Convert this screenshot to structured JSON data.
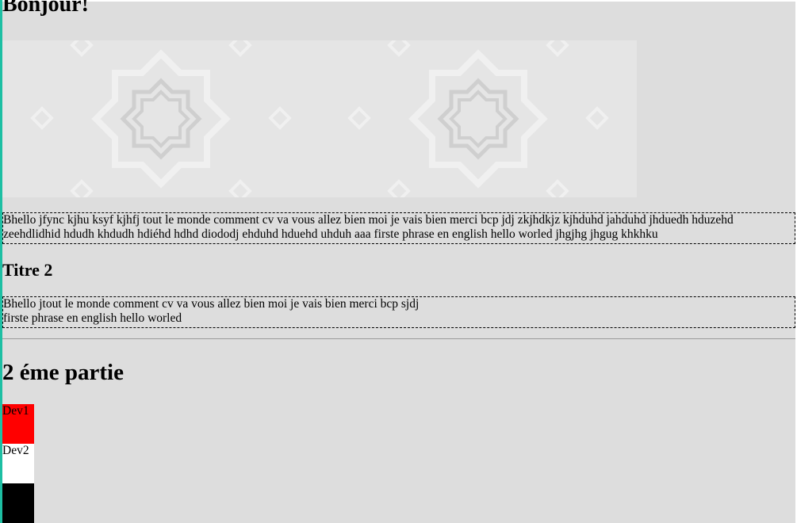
{
  "header": {
    "title": "Bonjour!"
  },
  "banner": {
    "pattern": "octagram-star-pattern",
    "color": "#e5e5e5",
    "motif_color": "#cccccc"
  },
  "paragraphs": [
    {
      "lines": [
        "Bhello jfync kjhu ksyf kjhfj tout le monde comment cv va vous allez bien moi je vais bien merci bcp jdj zkjhdkjz kjhduhd jahduhd jhduedh hduzehd",
        "zeehdlidhid hdudh khdudh hdiéhd hdhd diododj ehduhd hduehd uhduh aaa firste phrase en english hello worled jhgjhg jhgug khkhku"
      ]
    },
    {
      "lines": [
        "Bhello jtout le monde comment cv va vous allez bien moi je vais bien merci bcp sjdj",
        "firste phrase en english hello worled"
      ]
    }
  ],
  "section2": {
    "title": "Titre 2"
  },
  "section3": {
    "title": "2 éme partie"
  },
  "devs": [
    {
      "label": "Dev1",
      "color": "#ff0000"
    },
    {
      "label": "Dev2",
      "color": "#ffffff"
    },
    {
      "label": "",
      "color": "#000000"
    }
  ]
}
